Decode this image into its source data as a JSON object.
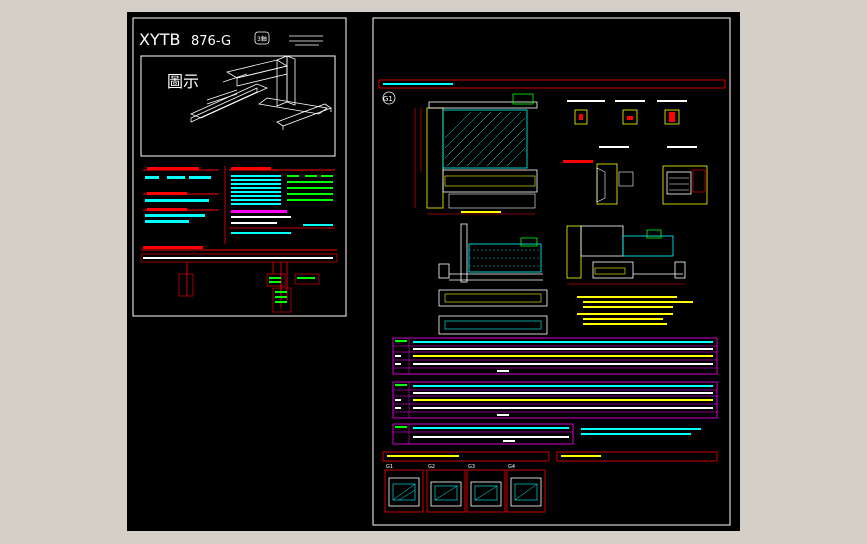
{
  "colors": {
    "background": "#000000",
    "window": "#d4d0c8",
    "frame": "#ffffff",
    "accent_red": "#ff0000",
    "cyan": "#00ffff",
    "yellow": "#ffff00",
    "green": "#00ff00",
    "magenta": "#ff00ff"
  },
  "left_sheet": {
    "model_prefix": "XYTB",
    "model_number": "876-G",
    "axis_badge": "3軸",
    "section_title": "圖示"
  },
  "right_sheet": {
    "view_label": "G1"
  },
  "detail_views": [
    {
      "label": "G1"
    },
    {
      "label": "G2"
    },
    {
      "label": "G3"
    },
    {
      "label": "G4"
    }
  ]
}
